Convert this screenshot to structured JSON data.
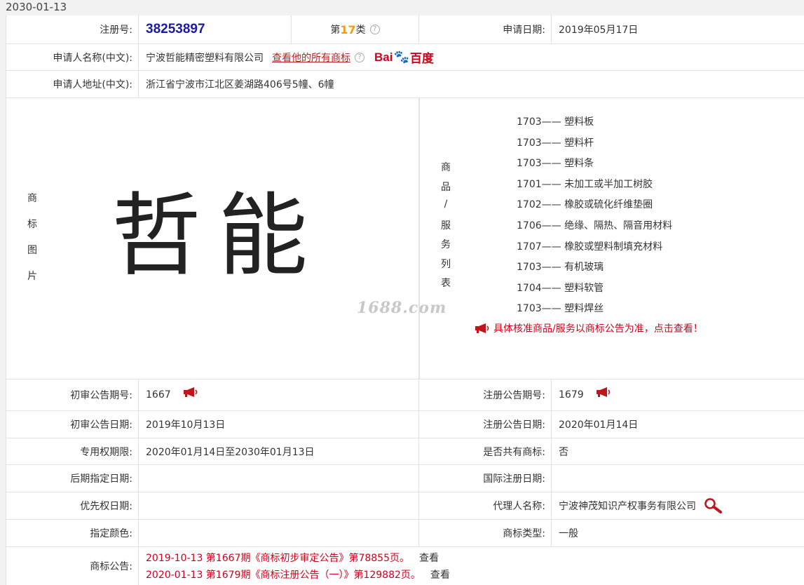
{
  "top_date": "2030-01-13",
  "reg": {
    "label": "注册号:",
    "number": "38253897",
    "class_prefix": "第",
    "class_num": "17",
    "class_suffix": "类",
    "apply_date_label": "申请日期:",
    "apply_date": "2019年05月17日"
  },
  "applicant": {
    "name_label": "申请人名称(中文):",
    "name": "宁波哲能精密塑料有限公司",
    "all_marks_link": "查看他的所有商标",
    "baidu_left": "Bai",
    "baidu_right": "百度",
    "address_label": "申请人地址(中文):",
    "address": "浙江省宁波市江北区姜湖路406号5幢、6幢"
  },
  "mark": {
    "label_chars": [
      "商",
      "标",
      "图",
      "片"
    ],
    "text": "哲能",
    "watermark": "1688.com"
  },
  "goods": {
    "label_chars": [
      "商",
      "品",
      "/",
      "服",
      "务",
      "列",
      "表"
    ],
    "items": [
      {
        "code": "1703",
        "sep": "——",
        "name": "塑料板"
      },
      {
        "code": "1703",
        "sep": "——",
        "name": "塑料杆"
      },
      {
        "code": "1703",
        "sep": "——",
        "name": "塑料条"
      },
      {
        "code": "1701",
        "sep": "——",
        "name": "未加工或半加工树胶"
      },
      {
        "code": "1702",
        "sep": "——",
        "name": "橡胶或硫化纤维垫圈"
      },
      {
        "code": "1706",
        "sep": "——",
        "name": "绝缘、隔热、隔音用材料"
      },
      {
        "code": "1707",
        "sep": "——",
        "name": "橡胶或塑料制填充材料"
      },
      {
        "code": "1703",
        "sep": "——",
        "name": "有机玻璃"
      },
      {
        "code": "1704",
        "sep": "——",
        "name": "塑料软管"
      },
      {
        "code": "1703",
        "sep": "——",
        "name": "塑料焊丝"
      }
    ],
    "notice": "具体核准商品/服务以商标公告为准，点击查看！"
  },
  "details": {
    "prelim_no_label": "初审公告期号:",
    "prelim_no": "1667",
    "reg_no_label": "注册公告期号:",
    "reg_no": "1679",
    "prelim_date_label": "初审公告日期:",
    "prelim_date": "2019年10月13日",
    "reg_date_label": "注册公告日期:",
    "reg_date": "2020年01月14日",
    "period_label": "专用权期限:",
    "period": "2020年01月14日至2030年01月13日",
    "shared_label": "是否共有商标:",
    "shared": "否",
    "later_label": "后期指定日期:",
    "later": "",
    "intl_label": "国际注册日期:",
    "intl": "",
    "priority_label": "优先权日期:",
    "priority": "",
    "agent_label": "代理人名称:",
    "agent": "宁波神茂知识产权事务有限公司",
    "color_label": "指定颜色:",
    "color": "",
    "type_label": "商标类型:",
    "type": "一般",
    "announce_label": "商标公告:",
    "announcements": [
      {
        "text": "2019-10-13 第1667期《商标初步审定公告》第78855页。",
        "action": "查看"
      },
      {
        "text": "2020-01-13 第1679期《商标注册公告（一）》第129882页。",
        "action": "查看"
      }
    ]
  },
  "colors": {
    "accent_red": "#d0021b",
    "reg_blue": "#1a1aa6",
    "class_orange": "#f39c12",
    "border": "#e2e2e2"
  }
}
